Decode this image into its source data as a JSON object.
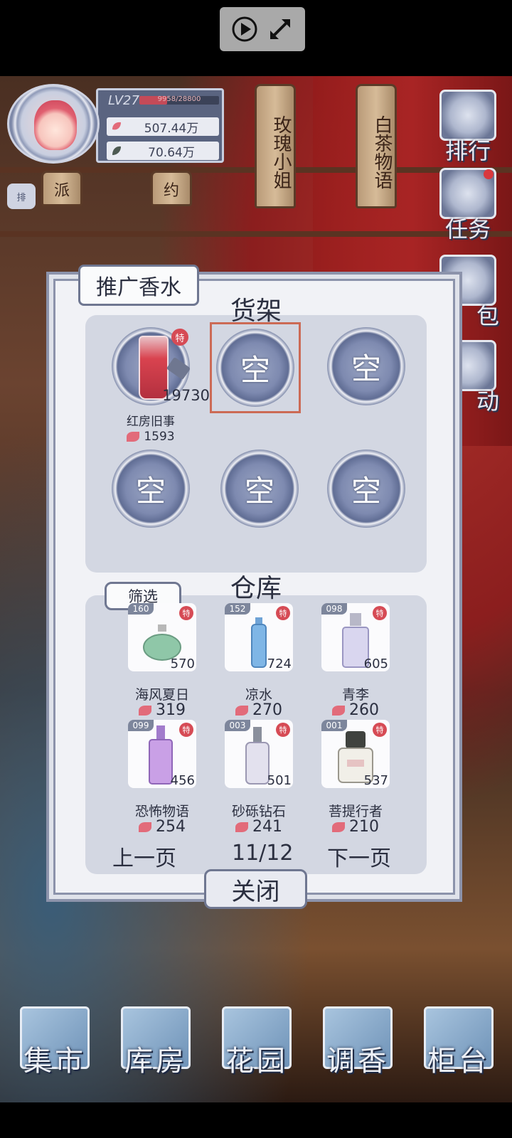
{
  "player": {
    "level": "LV27",
    "xp_text": "9958/28800",
    "xp_fraction": 0.346,
    "currency_petals": "507.44万",
    "currency_leaves": "70.64万",
    "rank_badge": "排"
  },
  "scene_tags": [
    "玫瑰小姐",
    "白茶物语",
    "派",
    "约"
  ],
  "side_menu": [
    {
      "label": "排行",
      "icon": "ranking-icon"
    },
    {
      "label": "任务",
      "icon": "task-scroll-icon",
      "notify": true
    },
    {
      "label": "包",
      "icon": "bag-icon"
    },
    {
      "label": "动",
      "icon": "event-icon"
    }
  ],
  "modal": {
    "title": "推广香水",
    "shelf_heading": "货架",
    "store_heading": "仓库",
    "filter_label": "筛选",
    "close_label": "关闭",
    "empty_label": "空",
    "hot_label": "特",
    "shelf": [
      {
        "name": "红房旧事",
        "count": "19730",
        "price": "1593",
        "hot": true,
        "filled": true
      },
      {
        "filled": false,
        "selected": true
      },
      {
        "filled": false
      },
      {
        "filled": false
      },
      {
        "filled": false
      },
      {
        "filled": false
      }
    ],
    "store": [
      {
        "num": "160",
        "name": "海风夏日",
        "qty": "570",
        "price": "319",
        "hot": true,
        "color": "#8fc7a8"
      },
      {
        "num": "152",
        "name": "凉水",
        "qty": "724",
        "price": "270",
        "hot": true,
        "color": "#7fb6e6"
      },
      {
        "num": "098",
        "name": "青李",
        "qty": "605",
        "price": "260",
        "hot": true,
        "color": "#c9c3e8"
      },
      {
        "num": "099",
        "name": "恐怖物语",
        "qty": "456",
        "price": "254",
        "hot": true,
        "color": "#c9a0e6"
      },
      {
        "num": "003",
        "name": "砂砾钻石",
        "qty": "501",
        "price": "241",
        "hot": true,
        "color": "#cdc9e0"
      },
      {
        "num": "001",
        "name": "菩提行者",
        "qty": "537",
        "price": "210",
        "hot": true,
        "color": "#5a5e57"
      }
    ],
    "pager": {
      "prev": "上一页",
      "page": "11/12",
      "next": "下一页"
    }
  },
  "bottom_nav": [
    {
      "label": "集市",
      "icon": "market-icon"
    },
    {
      "label": "库房",
      "icon": "warehouse-icon"
    },
    {
      "label": "花园",
      "icon": "garden-rose-icon"
    },
    {
      "label": "调香",
      "icon": "perfume-mixing-icon"
    },
    {
      "label": "柜台",
      "icon": "counter-icon"
    }
  ]
}
